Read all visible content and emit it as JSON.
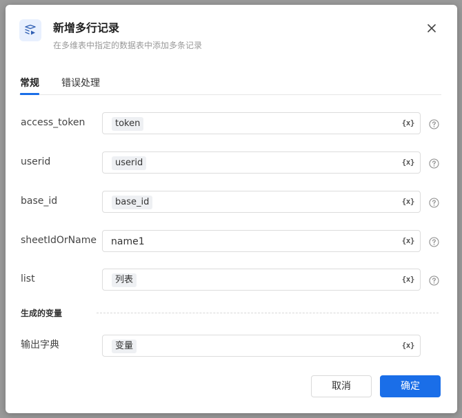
{
  "dialog": {
    "title": "新增多行记录",
    "subtitle": "在多维表中指定的数据表中添加多条记录",
    "icon": "table-add-icon"
  },
  "tabs": [
    {
      "label": "常规",
      "active": true
    },
    {
      "label": "错误处理",
      "active": false
    }
  ],
  "fields": [
    {
      "label": "access_token",
      "value": "token",
      "type": "variable"
    },
    {
      "label": "userid",
      "value": "userid",
      "type": "variable"
    },
    {
      "label": "base_id",
      "value": "base_id",
      "type": "variable"
    },
    {
      "label": "sheetIdOrName",
      "value": "name1",
      "type": "text"
    },
    {
      "label": "list",
      "value": "列表",
      "type": "variable"
    }
  ],
  "variable_button": "{x}",
  "output_section": {
    "title": "生成的变量",
    "label": "输出字典",
    "value": "变量"
  },
  "footer": {
    "cancel_label": "取消",
    "ok_label": "确定"
  },
  "colors": {
    "primary": "#1a6ee8",
    "tab_active": "#1a6ee8",
    "chip_bg": "#eef0f3"
  }
}
